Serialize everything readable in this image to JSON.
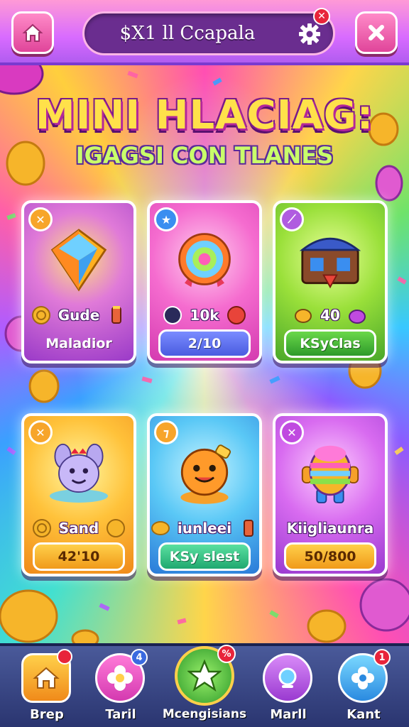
{
  "topbar": {
    "title": "$X1 ll Ccapala",
    "settings_badge": "✕",
    "home_icon": "home-icon",
    "settings_icon": "gear-icon",
    "close_icon": "close-icon"
  },
  "headline": {
    "title": "MINI HLACIAG:",
    "subtitle": "IGAGSI CON TLANES"
  },
  "cards": [
    {
      "badge": "✕",
      "stat": "Gude",
      "action": "Maladior",
      "theme": "#b24ad6",
      "action_color": "transparent"
    },
    {
      "badge": "★",
      "stat": "10k",
      "action": "2/10",
      "theme": "#f04fb3",
      "action_color": "#5a6cf0"
    },
    {
      "badge": "⟋",
      "stat": "40",
      "action": "KSyClas",
      "theme": "#7ad93a",
      "action_color": "#3aa83a"
    },
    {
      "badge": "✕",
      "stat": "Sand",
      "action": "42'10",
      "theme": "#f7b52a",
      "action_color": "#f0a020"
    },
    {
      "badge": "⁊",
      "stat": "iunleei",
      "action": "KSy slest",
      "theme": "#3ab6f0",
      "action_color": "#2ec78a"
    },
    {
      "badge": "✕",
      "stat": "Kiigliaunra",
      "action": "50/800",
      "theme": "#c04ae0",
      "action_color": "#f0a020"
    }
  ],
  "bottom_nav": [
    {
      "label": "Brep",
      "icon": "home-icon",
      "badge": "",
      "color": "#f7a52a"
    },
    {
      "label": "Taril",
      "icon": "flower-icon",
      "badge": "4",
      "color": "#e94fb8"
    },
    {
      "label": "Mcengisians",
      "icon": "star-icon",
      "badge": "%",
      "color": "#4fcf3a"
    },
    {
      "label": "Marll",
      "icon": "magnifier-icon",
      "badge": "",
      "color": "#b05ce0"
    },
    {
      "label": "Kant",
      "icon": "flower-icon",
      "badge": "1",
      "color": "#37b6f0"
    }
  ],
  "colors": {
    "topbar": "#d86bff",
    "title_pill": "#6a2d8f",
    "headline": "#ffe14a",
    "subline": "#c9ff6a",
    "nav_bg": "#2f3f7a"
  }
}
